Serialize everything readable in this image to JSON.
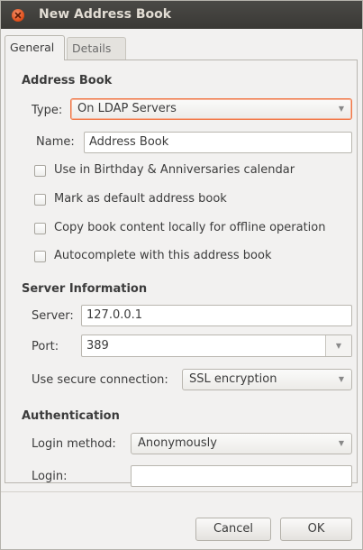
{
  "window": {
    "title": "New Address Book"
  },
  "tabs": [
    {
      "label": "General"
    },
    {
      "label": "Details"
    }
  ],
  "address_book": {
    "heading": "Address Book",
    "type_label": "Type:",
    "type_value": "On LDAP Servers",
    "name_label": "Name:",
    "name_value": "Address Book",
    "checkboxes": [
      {
        "label": "Use in Birthday & Anniversaries calendar",
        "checked": false
      },
      {
        "label": "Mark as default address book",
        "checked": false
      },
      {
        "label": "Copy book content locally for offline operation",
        "checked": false
      },
      {
        "label": "Autocomplete with this address book",
        "checked": false
      }
    ]
  },
  "server": {
    "heading": "Server Information",
    "server_label": "Server:",
    "server_value": "127.0.0.1",
    "port_label": "Port:",
    "port_value": "389",
    "secure_label": "Use secure connection:",
    "secure_value": "SSL encryption"
  },
  "auth": {
    "heading": "Authentication",
    "method_label": "Login method:",
    "method_value": "Anonymously",
    "login_label": "Login:",
    "login_value": ""
  },
  "buttons": {
    "cancel": "Cancel",
    "ok": "OK"
  }
}
